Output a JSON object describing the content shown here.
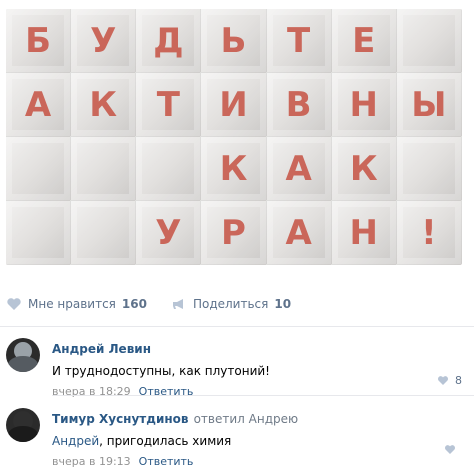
{
  "photo": {
    "letters": [
      {
        "t": "Б",
        "row": 0,
        "col": 0
      },
      {
        "t": "У",
        "row": 0,
        "col": 1
      },
      {
        "t": "Д",
        "row": 0,
        "col": 2
      },
      {
        "t": "Ь",
        "row": 0,
        "col": 3
      },
      {
        "t": "Т",
        "row": 0,
        "col": 4
      },
      {
        "t": "Е",
        "row": 0,
        "col": 5
      },
      {
        "t": "А",
        "row": 1,
        "col": 0
      },
      {
        "t": "К",
        "row": 1,
        "col": 1
      },
      {
        "t": "Т",
        "row": 1,
        "col": 2
      },
      {
        "t": "И",
        "row": 1,
        "col": 3
      },
      {
        "t": "В",
        "row": 1,
        "col": 4
      },
      {
        "t": "Н",
        "row": 1,
        "col": 5
      },
      {
        "t": "Ы",
        "row": 1,
        "col": 6
      },
      {
        "t": "К",
        "row": 2,
        "col": 3
      },
      {
        "t": "А",
        "row": 2,
        "col": 4
      },
      {
        "t": "К",
        "row": 2,
        "col": 5
      },
      {
        "t": "У",
        "row": 3,
        "col": 2
      },
      {
        "t": "Р",
        "row": 3,
        "col": 3
      },
      {
        "t": "А",
        "row": 3,
        "col": 4
      },
      {
        "t": "Н",
        "row": 3,
        "col": 5
      },
      {
        "t": "!",
        "row": 3,
        "col": 6
      }
    ],
    "accent": "#c85a4c"
  },
  "actions": {
    "like_label": "Мне нравится",
    "like_count": "160",
    "share_label": "Поделиться",
    "share_count": "10"
  },
  "comments": [
    {
      "author": "Андрей Левин",
      "text": "И труднодоступны, как плутоний!",
      "time": "вчера в 18:29",
      "reply_label": "Ответить",
      "likes": "8"
    },
    {
      "author": "Тимур Хуснутдинов",
      "reply_to": "ответил Андрею",
      "mention": "Андрей",
      "text": ", пригодилась химия",
      "time": "вчера в 19:13",
      "reply_label": "Ответить",
      "likes": ""
    }
  ],
  "icons": {
    "like": "heart-icon",
    "share": "megaphone-icon"
  }
}
